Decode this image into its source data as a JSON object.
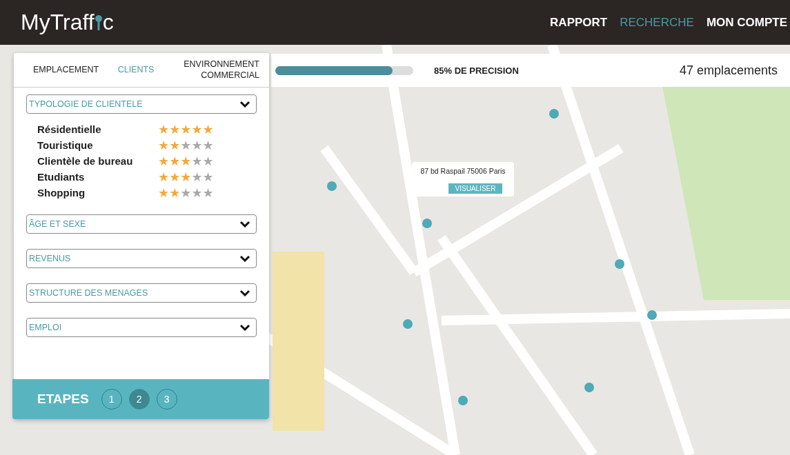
{
  "header": {
    "logo": {
      "before": "MyTraff",
      "after": "c"
    },
    "nav": [
      {
        "label": "RAPPORT",
        "selected": false
      },
      {
        "label": "RECHERCHE",
        "selected": true
      },
      {
        "label": "MON COMPTE",
        "selected": false
      }
    ]
  },
  "panel": {
    "tabs": [
      {
        "label": "EMPLACEMENT",
        "selected": false
      },
      {
        "label": "CLIENTS",
        "selected": true
      },
      {
        "label": "ENVIRONNEMENT COMMERCIAL",
        "selected": false
      }
    ],
    "sections": [
      {
        "title": "TYPOLOGIE DE CLIENTELE",
        "ratings": [
          {
            "label": "Résidentielle",
            "stars": 5
          },
          {
            "label": "Touristique",
            "stars": 2
          },
          {
            "label": "Clientèle de bureau",
            "stars": 3
          },
          {
            "label": "Etudiants",
            "stars": 3
          },
          {
            "label": "Shopping",
            "stars": 2
          }
        ]
      },
      {
        "title": "ÂGE ET SEXE"
      },
      {
        "title": "REVENUS"
      },
      {
        "title": "STRUCTURE DES MENAGES"
      },
      {
        "title": "EMPLOI"
      }
    ],
    "steps": {
      "label": "ETAPES",
      "items": [
        {
          "label": "1",
          "selected": false
        },
        {
          "label": "2",
          "selected": true
        },
        {
          "label": "3",
          "selected": false
        }
      ]
    }
  },
  "precision": {
    "level": 0.85,
    "label": "85% DE PRECISION"
  },
  "count": "47 emplacements",
  "popup": {
    "address": "87 bd Raspail 75006 Paris",
    "button": "VISUALISER"
  }
}
